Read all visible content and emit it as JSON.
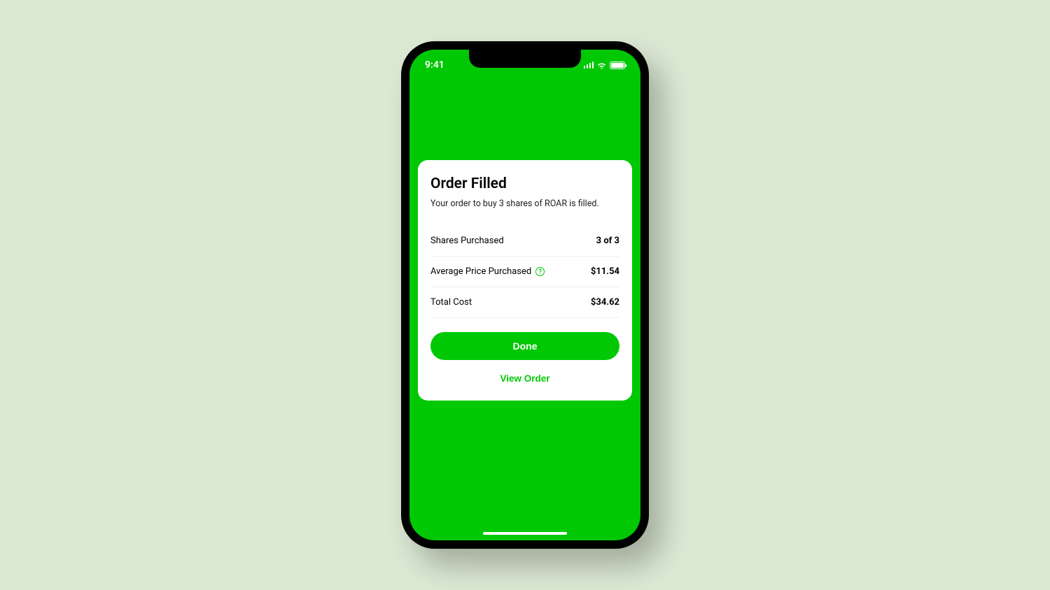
{
  "status_bar": {
    "time": "9:41"
  },
  "card": {
    "title": "Order Filled",
    "subtitle": "Your order to buy 3 shares of ROAR is filled.",
    "rows": [
      {
        "label": "Shares Purchased",
        "value": "3 of 3",
        "has_info": false
      },
      {
        "label": "Average Price Purchased",
        "value": "$11.54",
        "has_info": true
      },
      {
        "label": "Total Cost",
        "value": "$34.62",
        "has_info": false
      }
    ],
    "done_label": "Done",
    "view_order_label": "View Order"
  },
  "colors": {
    "brand_green": "#00c805",
    "background": "#dbe8d4"
  }
}
